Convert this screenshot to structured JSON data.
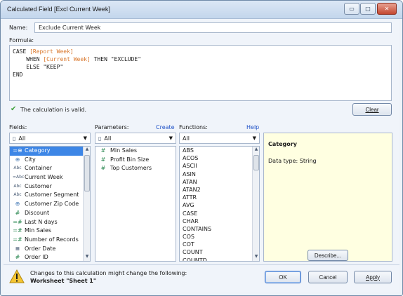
{
  "window": {
    "title": "Calculated Field [Excl Current Week]",
    "minimize_symbol": "▭",
    "maximize_symbol": "□",
    "close_symbol": "✕"
  },
  "name": {
    "label": "Name:",
    "value": "Exclude Current Week"
  },
  "formula": {
    "label": "Formula:",
    "lines": [
      [
        {
          "t": "CASE ",
          "c": "kw"
        },
        {
          "t": "[Report Week]",
          "c": "fieldref"
        }
      ],
      [
        {
          "t": "    WHEN ",
          "c": "kw"
        },
        {
          "t": "[Current Week]",
          "c": "fieldref"
        },
        {
          "t": " THEN \"EXCLUDE\"",
          "c": "kw"
        }
      ],
      [
        {
          "t": "    ELSE \"KEEP\"",
          "c": "kw"
        }
      ],
      [
        {
          "t": "END",
          "c": "kw"
        }
      ]
    ]
  },
  "status": {
    "icon": "checkmark-icon",
    "text": "The calculation is valid."
  },
  "clear_button": "Clear",
  "fields": {
    "label": "Fields:",
    "filter": "All",
    "items": [
      {
        "icon": "=⊕",
        "kind": "globe",
        "label": "Category",
        "selected": true
      },
      {
        "icon": "⊕",
        "kind": "globe",
        "label": "City"
      },
      {
        "icon": "Abc",
        "kind": "abc",
        "label": "Container"
      },
      {
        "icon": "=Abc",
        "kind": "abc",
        "label": "Current Week"
      },
      {
        "icon": "Abc",
        "kind": "abc",
        "label": "Customer"
      },
      {
        "icon": "Abc",
        "kind": "abc",
        "label": "Customer Segment"
      },
      {
        "icon": "⊕",
        "kind": "globe",
        "label": "Customer Zip Code"
      },
      {
        "icon": "#",
        "kind": "hash",
        "label": "Discount"
      },
      {
        "icon": "=#",
        "kind": "hash",
        "label": "Last N days"
      },
      {
        "icon": "=#",
        "kind": "hash",
        "label": "Min Sales"
      },
      {
        "icon": "=#",
        "kind": "hash",
        "label": "Number of Records"
      },
      {
        "icon": "▦",
        "kind": "abc",
        "label": "Order Date"
      },
      {
        "icon": "#",
        "kind": "hash",
        "label": "Order ID"
      }
    ]
  },
  "parameters": {
    "label": "Parameters:",
    "create_link": "Create",
    "filter": "All",
    "items": [
      {
        "icon": "#",
        "label": "Min Sales"
      },
      {
        "icon": "#",
        "label": "Profit Bin Size"
      },
      {
        "icon": "#",
        "label": "Top Customers"
      }
    ]
  },
  "functions": {
    "label": "Functions:",
    "help_link": "Help",
    "filter": "All",
    "items": [
      "ABS",
      "ACOS",
      "ASCII",
      "ASIN",
      "ATAN",
      "ATAN2",
      "ATTR",
      "AVG",
      "CASE",
      "CHAR",
      "CONTAINS",
      "COS",
      "COT",
      "COUNT",
      "COUNTD"
    ]
  },
  "info": {
    "title": "Category",
    "datatype": "Data type: String",
    "describe_button": "Describe..."
  },
  "footer": {
    "warning_icon": "warning-icon",
    "warning_text": "Changes to this calculation might change the following:",
    "worksheet": "Worksheet \"Sheet 1\"",
    "ok": "OK",
    "cancel": "Cancel",
    "apply": "Apply"
  },
  "colors": {
    "selection": "#3d86e6",
    "field_reference": "#d9762a",
    "link": "#1f52c7",
    "info_background": "#ffffe1"
  }
}
